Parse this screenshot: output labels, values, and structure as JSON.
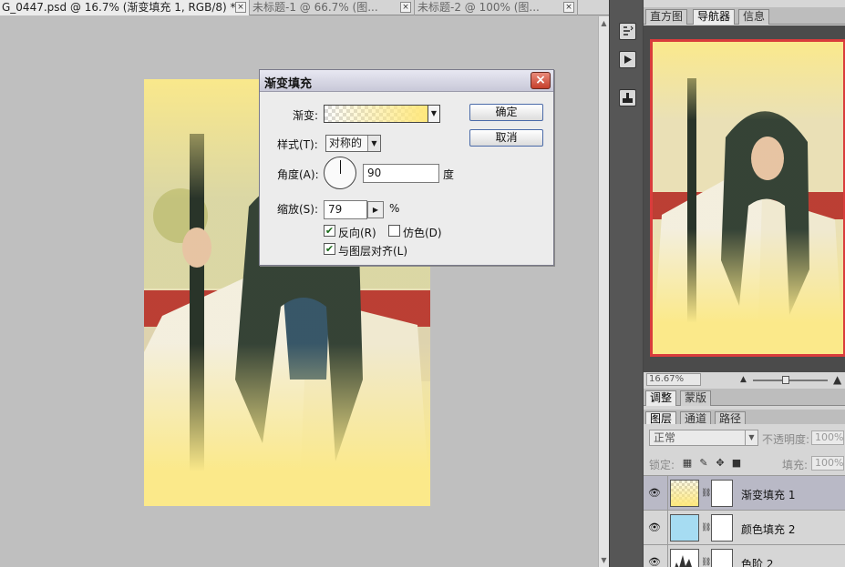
{
  "doc_tabs": [
    {
      "label": "G_0447.psd @ 16.7% (渐变填充 1, RGB/8) *",
      "close": "×"
    },
    {
      "label": "未标题-1 @ 66.7% (图...",
      "close": "×"
    },
    {
      "label": "未标题-2 @ 100% (图...",
      "close": "×"
    }
  ],
  "panel_top_tabs": [
    "直方图",
    "导航器",
    "信息"
  ],
  "navigator": {
    "zoom": "16.67%"
  },
  "adjust_tabs": [
    "调整",
    "蒙版"
  ],
  "layers_tabs": [
    "图层",
    "通道",
    "路径"
  ],
  "layers": {
    "blend_mode": "正常",
    "opacity_label": "不透明度:",
    "opacity_value": "100%",
    "lock_label": "锁定:",
    "fill_label": "填充:",
    "fill_value": "100%",
    "items": [
      {
        "name": "渐变填充 1",
        "selected": true
      },
      {
        "name": "颜色填充 2",
        "selected": false
      },
      {
        "name": "色阶 2",
        "selected": false
      }
    ]
  },
  "dialog": {
    "title": "渐变填充",
    "close": "×",
    "gradient_label": "渐变:",
    "style_label": "样式(T):",
    "style_value": "对称的",
    "angle_label": "角度(A):",
    "angle_value": "90",
    "angle_unit": "度",
    "scale_label": "缩放(S):",
    "scale_value": "79",
    "scale_unit": "%",
    "reverse_label": "反向(R)",
    "reverse_checked": true,
    "dither_label": "仿色(D)",
    "dither_checked": false,
    "align_label": "与图层对齐(L)",
    "align_checked": true,
    "ok_label": "确定",
    "cancel_label": "取消"
  },
  "colors": {
    "gradient_yellow": "#ffe87c",
    "navigator_frame": "#d93c3c"
  }
}
